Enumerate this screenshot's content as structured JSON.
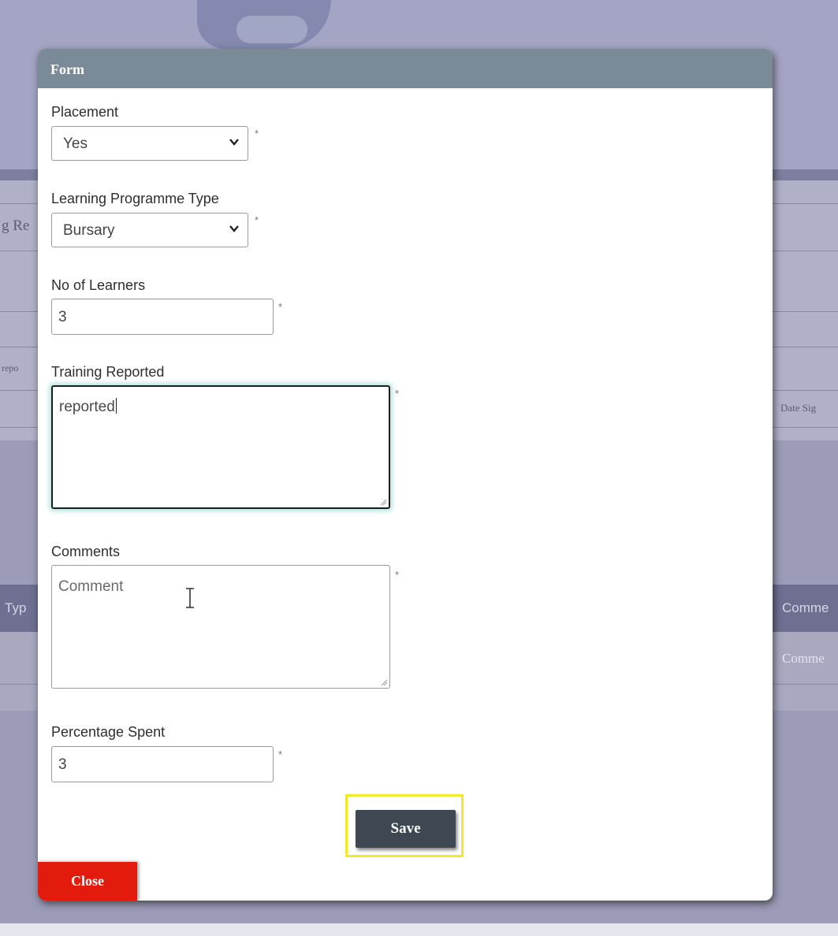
{
  "background": {
    "fragments": [
      "g Re",
      "repo",
      "Date Sig",
      "Typ",
      "Comme",
      "Comme"
    ]
  },
  "modal": {
    "title": "Form",
    "required_marker": "*",
    "placement": {
      "label": "Placement",
      "value": "Yes"
    },
    "programme_type": {
      "label": "Learning Programme Type",
      "value": "Bursary"
    },
    "learners": {
      "label": "No of Learners",
      "value": "3"
    },
    "training": {
      "label": "Training Reported",
      "value": "reported"
    },
    "comments": {
      "label": "Comments",
      "placeholder": "Comment"
    },
    "percentage": {
      "label": "Percentage Spent",
      "value": "3"
    },
    "save_label": "Save",
    "close_label": "Close"
  },
  "colors": {
    "header": "#7a8a97",
    "save": "#3d4852",
    "close": "#e21b0c",
    "highlight": "#f1ea2b"
  }
}
